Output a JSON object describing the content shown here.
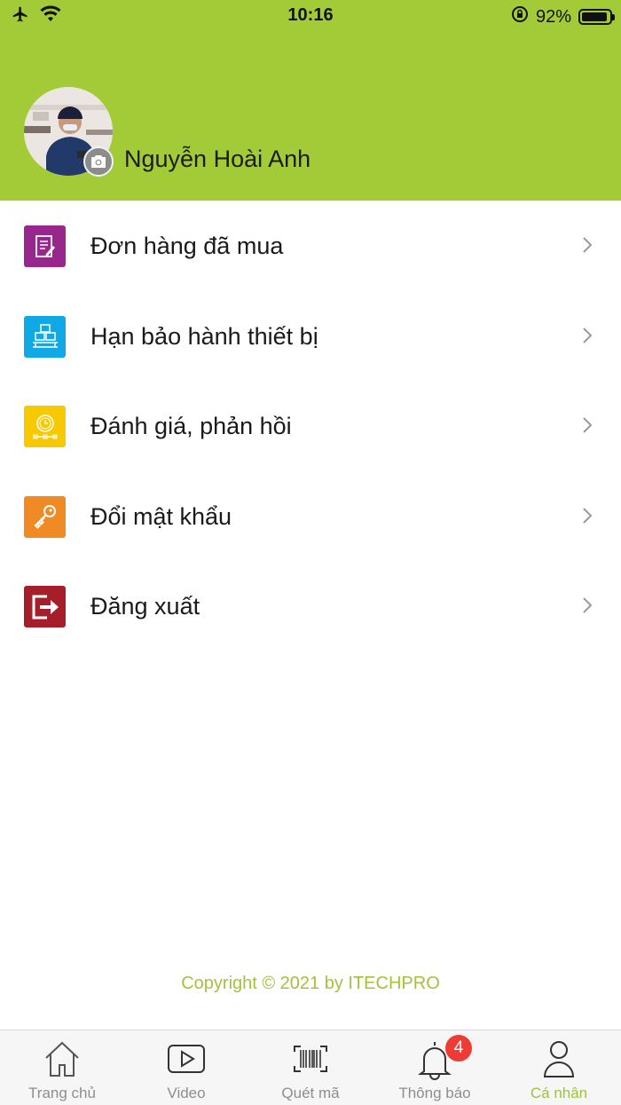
{
  "status_bar": {
    "time": "10:16",
    "battery_percent": "92%",
    "battery_level": 0.92,
    "icons": [
      "airplane-icon",
      "wifi-icon",
      "orientation-lock-icon",
      "battery-icon"
    ]
  },
  "profile": {
    "name": "Nguyễn Hoài Anh",
    "avatar_icon": "profile-photo",
    "camera_icon": "camera-icon"
  },
  "menu": {
    "items": [
      {
        "label": "Đơn hàng đã mua",
        "icon": "order-list-icon",
        "color": "#97268d"
      },
      {
        "label": "Hạn bảo hành thiết bị",
        "icon": "warranty-boxes-icon",
        "color": "#10a9e6"
      },
      {
        "label": "Đánh giá, phản hồi",
        "icon": "feedback-clock-icon",
        "color": "#f7c900"
      },
      {
        "label": "Đổi mật khẩu",
        "icon": "key-icon",
        "color": "#f08a24"
      },
      {
        "label": "Đăng xuất",
        "icon": "logout-icon",
        "color": "#a41f2a"
      }
    ]
  },
  "footer": {
    "copyright": "Copyright © 2021 by ITECHPRO"
  },
  "tabbar": {
    "tabs": [
      {
        "label": "Trang chủ",
        "icon": "home-icon"
      },
      {
        "label": "Video",
        "icon": "video-play-icon"
      },
      {
        "label": "Quét mã",
        "icon": "barcode-scan-icon"
      },
      {
        "label": "Thông báo",
        "icon": "bell-icon"
      },
      {
        "label": "Cá nhân",
        "icon": "person-icon"
      }
    ],
    "active": "Cá nhân",
    "notification_count": "4"
  },
  "colors": {
    "brand_green": "#a3cb38",
    "active_tab": "#9ec23a",
    "badge_red": "#ee3b36"
  }
}
